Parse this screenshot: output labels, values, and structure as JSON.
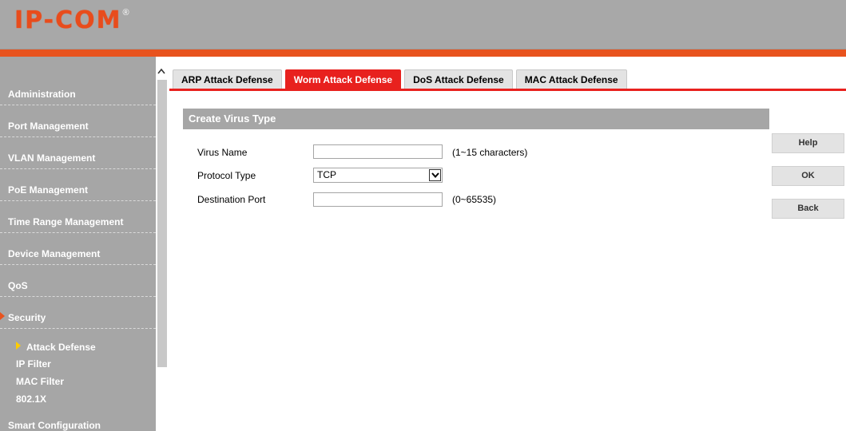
{
  "brand": {
    "logo": "IP-COM",
    "reg_mark": "®",
    "accent": "#e8531e"
  },
  "sidebar": {
    "items": [
      {
        "label": "Administration"
      },
      {
        "label": "Port Management"
      },
      {
        "label": "VLAN Management"
      },
      {
        "label": "PoE Management"
      },
      {
        "label": "Time Range Management"
      },
      {
        "label": "Device Management"
      },
      {
        "label": "QoS"
      },
      {
        "label": "Security",
        "active": true
      },
      {
        "label": "Smart Configuration"
      }
    ],
    "security_sub": [
      {
        "label": "Attack Defense",
        "active": true
      },
      {
        "label": "IP Filter"
      },
      {
        "label": "MAC Filter"
      },
      {
        "label": "802.1X"
      }
    ]
  },
  "tabs": [
    {
      "label": "ARP Attack Defense"
    },
    {
      "label": "Worm Attack Defense",
      "active": true
    },
    {
      "label": "DoS Attack Defense"
    },
    {
      "label": "MAC Attack Defense"
    }
  ],
  "panel": {
    "title": "Create Virus Type",
    "fields": {
      "virus_name": {
        "label": "Virus Name",
        "value": "",
        "hint": "(1~15 characters)"
      },
      "protocol_type": {
        "label": "Protocol Type",
        "value": "TCP"
      },
      "destination_port": {
        "label": "Destination Port",
        "value": "",
        "hint": "(0~65535)"
      }
    }
  },
  "buttons": {
    "help": "Help",
    "ok": "OK",
    "back": "Back"
  }
}
